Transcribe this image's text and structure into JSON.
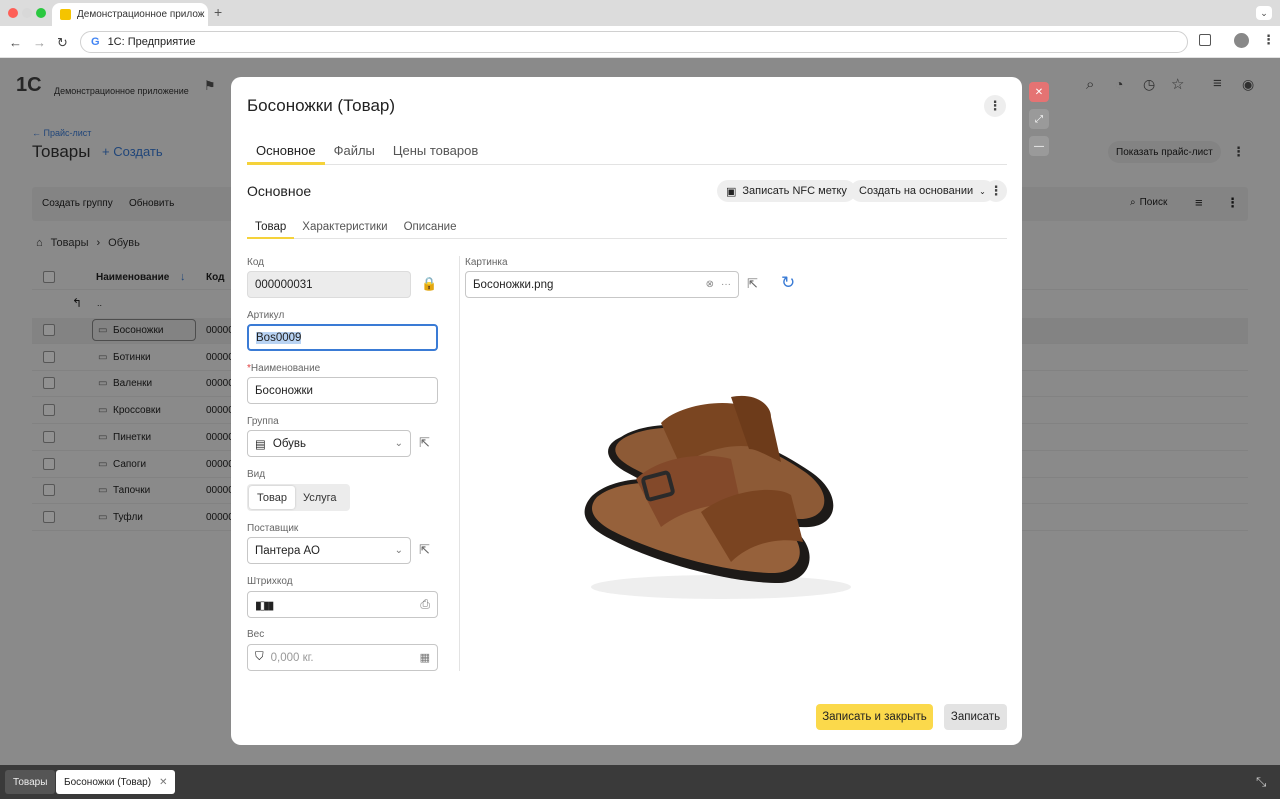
{
  "browser": {
    "tab_title": "Демонстрационное прилож",
    "tab_close": "✕",
    "new_tab": "+",
    "address": "1С: Предприятие"
  },
  "background": {
    "logo": "1С",
    "app_name": "Демонстрационное приложение",
    "back_link": "← Прайс-лист",
    "page_title": "Товары",
    "create": "Создать",
    "show_pricelist": "Показать прайс-лист",
    "toolbar": [
      "Создать группу",
      "Обновить"
    ],
    "search": "Поиск",
    "breadcrumb": [
      "Товары",
      "Обувь"
    ],
    "col_name": "Наименование",
    "col_code": "Код",
    "parent_row": "..",
    "rows": [
      {
        "name": "Босоножки",
        "code": "00000"
      },
      {
        "name": "Ботинки",
        "code": "00000"
      },
      {
        "name": "Валенки",
        "code": "00000"
      },
      {
        "name": "Кроссовки",
        "code": "00000"
      },
      {
        "name": "Пинетки",
        "code": "00000"
      },
      {
        "name": "Сапоги",
        "code": "00000"
      },
      {
        "name": "Тапочки",
        "code": "00000"
      },
      {
        "name": "Туфли",
        "code": "00000"
      }
    ]
  },
  "modal": {
    "title": "Босоножки (Товар)",
    "tabs": [
      "Основное",
      "Файлы",
      "Цены товаров"
    ],
    "active_tab": 0,
    "section_title": "Основное",
    "nfc_button": "Записать NFC метку",
    "create_based": "Создать на основании",
    "subtabs": [
      "Товар",
      "Характеристики",
      "Описание"
    ],
    "active_subtab": 0,
    "fields": {
      "code_label": "Код",
      "code_value": "000000031",
      "article_label": "Артикул",
      "article_value": "Bos0009",
      "name_label": "Наименование",
      "name_required": "*",
      "name_value": "Босоножки",
      "group_label": "Группа",
      "group_value": "Обувь",
      "kind_label": "Вид",
      "kind_options": [
        "Товар",
        "Услуга"
      ],
      "kind_selected": 0,
      "supplier_label": "Поставщик",
      "supplier_value": "Пантера АО",
      "barcode_label": "Штрихкод",
      "barcode_value": "",
      "weight_label": "Вес",
      "weight_placeholder": "0,000 кг."
    },
    "picture_label": "Картинка",
    "picture_file": "Босоножки.png",
    "save_close": "Записать и закрыть",
    "save": "Записать"
  },
  "taskbar": [
    "Товары",
    "Босоножки (Товар)"
  ],
  "colors": {
    "accent_yellow": "#fbd94b",
    "focus_blue": "#3a7bd5",
    "close_red": "#e57373"
  }
}
